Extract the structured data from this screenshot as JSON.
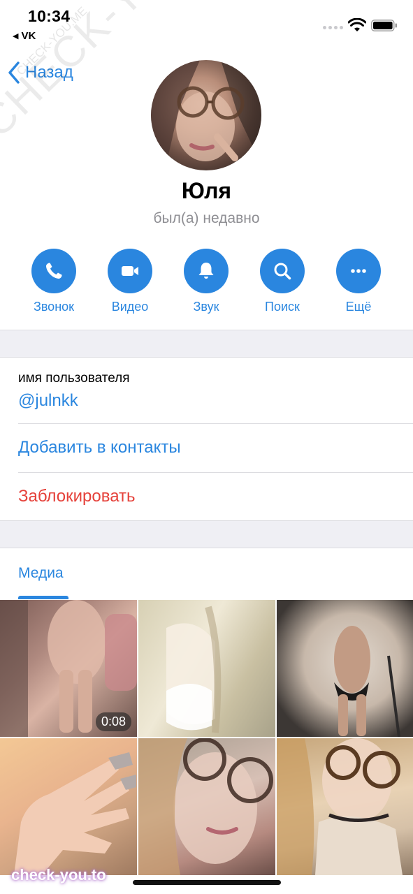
{
  "status_bar": {
    "time": "10:34",
    "back_app": "VK",
    "back_app_icon": "triangle-left-icon",
    "icons": [
      "signal-dots-icon",
      "wifi-icon",
      "battery-icon"
    ]
  },
  "nav": {
    "back_label": "Назад",
    "back_icon": "chevron-left-icon"
  },
  "profile": {
    "name": "Юля",
    "status": "был(а) недавно"
  },
  "actions": [
    {
      "label": "Звонок",
      "icon": "phone-icon"
    },
    {
      "label": "Видео",
      "icon": "video-camera-icon"
    },
    {
      "label": "Звук",
      "icon": "bell-icon"
    },
    {
      "label": "Поиск",
      "icon": "search-icon"
    },
    {
      "label": "Ещё",
      "icon": "more-dots-icon"
    }
  ],
  "info": {
    "username_label": "имя пользователя",
    "username_value": "@julnkk",
    "add_contact": "Добавить в контакты",
    "block": "Заблокировать"
  },
  "media": {
    "tab_label": "Медиа",
    "video_duration": "0:08"
  },
  "watermarks": {
    "diagonal": "CHECK-YOU.ME",
    "small": "CHECK-YOU.ME",
    "bottom": "check-you.to"
  },
  "colors": {
    "accent": "#2a86df",
    "destructive": "#e5413a",
    "secondary_text": "#8e8e93",
    "section_background": "#efeff4"
  }
}
